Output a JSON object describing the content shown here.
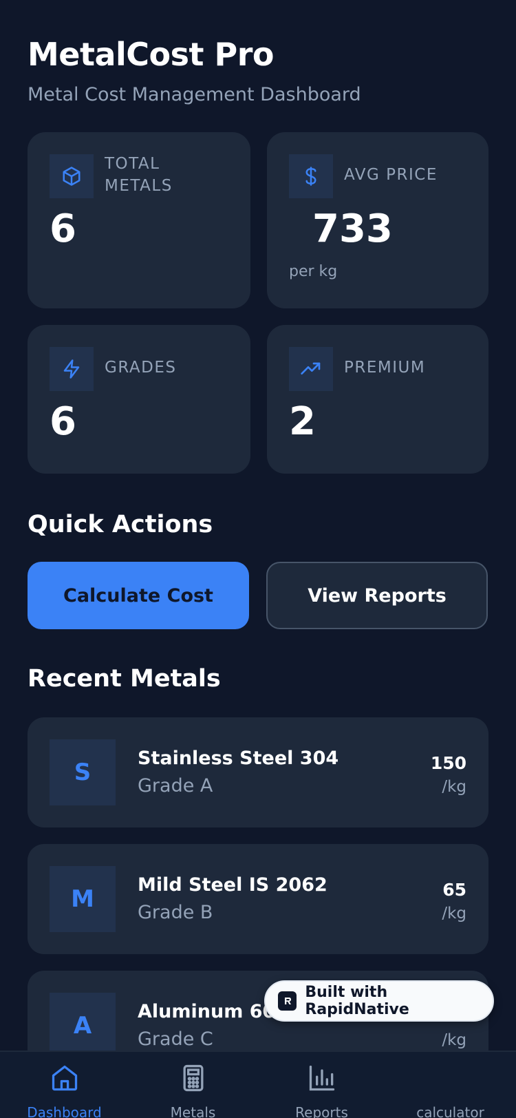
{
  "header": {
    "title": "MetalCost Pro",
    "subtitle": "Metal Cost Management Dashboard"
  },
  "stats": [
    {
      "label": "TOTAL METALS",
      "value": "6",
      "unit": "",
      "icon": "cube-icon"
    },
    {
      "label": "AVG PRICE",
      "value": "733",
      "unit": "per kg",
      "icon": "dollar-icon"
    },
    {
      "label": "GRADES",
      "value": "6",
      "unit": "",
      "icon": "lightning-icon"
    },
    {
      "label": "PREMIUM",
      "value": "2",
      "unit": "",
      "icon": "trending-up-icon"
    }
  ],
  "quick_actions": {
    "title": "Quick Actions",
    "calculate_label": "Calculate Cost",
    "reports_label": "View Reports"
  },
  "recent": {
    "title": "Recent Metals",
    "items": [
      {
        "initial": "S",
        "name": "Stainless Steel 304",
        "grade": "Grade A",
        "price": "150",
        "unit": "/kg"
      },
      {
        "initial": "M",
        "name": "Mild Steel IS 2062",
        "grade": "Grade B",
        "price": "65",
        "unit": "/kg"
      },
      {
        "initial": "A",
        "name": "Aluminum 60",
        "grade": "Grade C",
        "price": "",
        "unit": "/kg"
      }
    ]
  },
  "badge": {
    "label": "Built with RapidNative"
  },
  "tabs": [
    {
      "label": "Dashboard",
      "icon": "home-icon",
      "active": true
    },
    {
      "label": "Metals",
      "icon": "calculator-icon",
      "active": false
    },
    {
      "label": "Reports",
      "icon": "bar-chart-icon",
      "active": false
    },
    {
      "label": "calculator",
      "icon": "",
      "active": false
    }
  ],
  "colors": {
    "background": "#0f172a",
    "card": "#1e293b",
    "accent": "#3b82f6",
    "muted_text": "#94a3b8"
  }
}
